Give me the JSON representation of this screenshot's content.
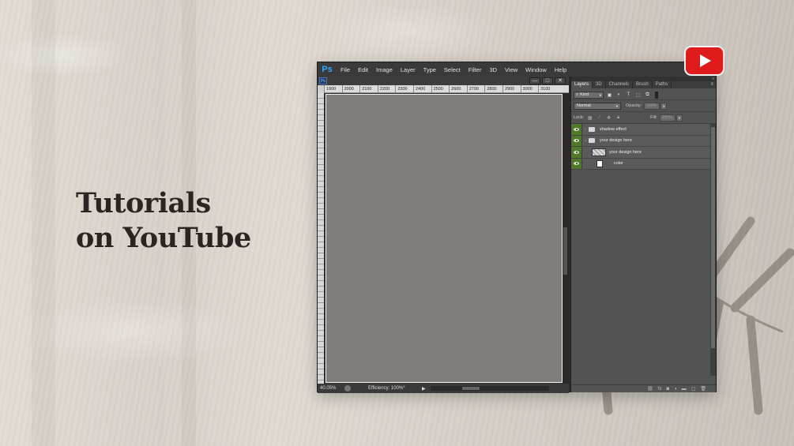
{
  "headline": {
    "line1": "Tutorials",
    "line2": "on YouTube"
  },
  "youtube_icon": "youtube-play-icon",
  "photoshop": {
    "logo": "Ps",
    "menu": [
      "File",
      "Edit",
      "Image",
      "Layer",
      "Type",
      "Select",
      "Filter",
      "3D",
      "View",
      "Window",
      "Help"
    ],
    "document_tab": "Ps",
    "window_buttons": {
      "minimize": "—",
      "restore": "□",
      "close": "✕"
    },
    "ruler_ticks": [
      "1900",
      "2000",
      "2100",
      "2200",
      "2300",
      "2400",
      "2500",
      "2600",
      "2700",
      "2800",
      "2900",
      "3000",
      "3100"
    ],
    "status": {
      "zoom": "40.05%",
      "efficiency": "Efficiency: 100%*"
    },
    "panel": {
      "tabs": [
        "Layers",
        "3D",
        "Channels",
        "Brush",
        "Paths"
      ],
      "kind_label": "Kind",
      "blend_mode": "Normal",
      "opacity_label": "Opacity:",
      "opacity_value": "100%",
      "lock_label": "Lock:",
      "fill_label": "Fill:",
      "fill_value": "100%",
      "layers": [
        {
          "name": "shadow effect",
          "type": "folder",
          "indent": 0
        },
        {
          "name": "your design here",
          "type": "folder",
          "indent": 0
        },
        {
          "name": "your design here",
          "type": "smart-object",
          "indent": 1
        },
        {
          "name": "color",
          "type": "fill",
          "indent": 1
        }
      ],
      "footer_icons": [
        "link-icon",
        "fx-icon",
        "mask-icon",
        "adjustment-icon",
        "group-folder-icon",
        "new-layer-icon",
        "trash-icon"
      ]
    }
  },
  "colors": {
    "ps_blue": "#31a8ff",
    "visibility_green": "#4f7a2a",
    "youtube_red": "#e01b1b",
    "panel_gray": "#535353"
  }
}
